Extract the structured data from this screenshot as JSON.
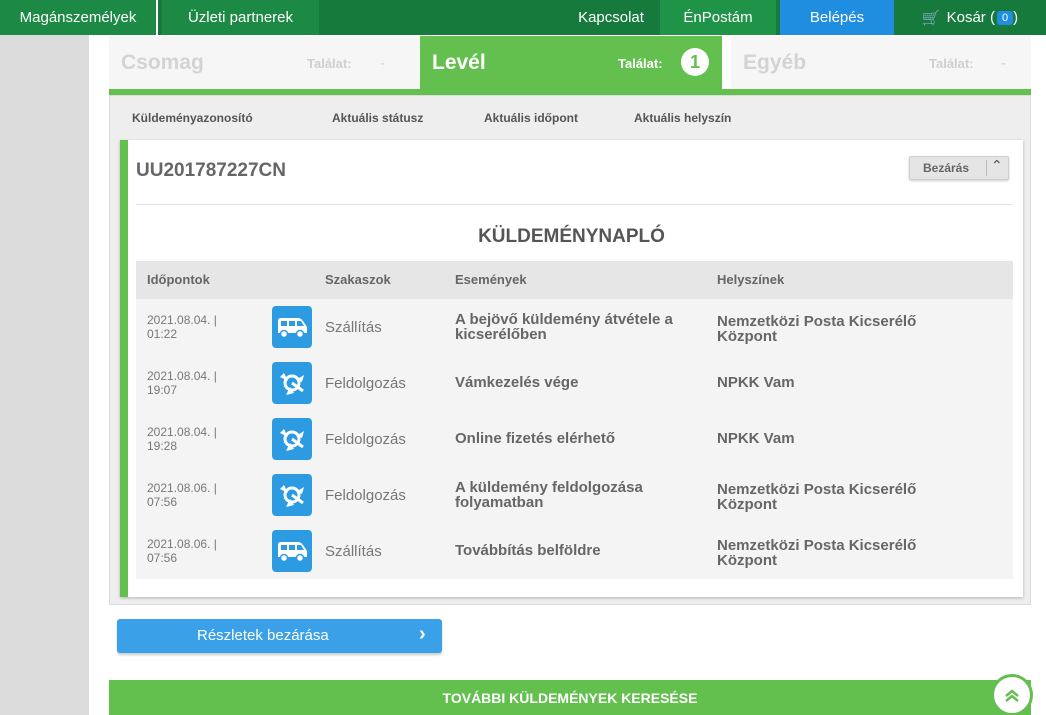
{
  "topnav": {
    "private_label": "Magánszemélyek",
    "business_label": "Üzleti partnerek",
    "contact_label": "Kapcsolat",
    "enpostam_label": "ÉnPostám",
    "login_label": "Belépés",
    "cart_label": "Kosár (",
    "cart_count": "0",
    "cart_close": ")"
  },
  "categories": {
    "csomag": {
      "name": "Csomag",
      "hit_label": "Találat:",
      "hit_value": "-"
    },
    "level": {
      "name": "Levél",
      "hit_label": "Találat:",
      "hit_value": "1"
    },
    "egyeb": {
      "name": "Egyéb",
      "hit_label": "Találat:",
      "hit_value": "-"
    }
  },
  "columns": {
    "id": "Küldeményazonosító",
    "status": "Aktuális státusz",
    "time": "Aktuális időpont",
    "location": "Aktuális helyszín"
  },
  "shipment": {
    "tracking_id": "UU201787227CN",
    "close_label": "Bezárás",
    "log_title": "KÜLDEMÉNYNAPLÓ",
    "headers": {
      "time": "Időpontok",
      "stage": "Szakaszok",
      "event": "Események",
      "location": "Helyszínek"
    },
    "rows": [
      {
        "date": "2021.08.04. |",
        "time": "01:22",
        "icon": "van-icon",
        "stage": "Szállítás",
        "event": "A bejövő küldemény átvétele a kicserélőben",
        "location": "Nemzetközi Posta Kicserélő Központ"
      },
      {
        "date": "2021.08.04. |",
        "time": "19:07",
        "icon": "processing-icon",
        "stage": "Feldolgozás",
        "event": "Vámkezelés vége",
        "location": "NPKK Vam"
      },
      {
        "date": "2021.08.04. |",
        "time": "19:28",
        "icon": "processing-icon",
        "stage": "Feldolgozás",
        "event": "Online fizetés elérhető",
        "location": "NPKK Vam"
      },
      {
        "date": "2021.08.06. |",
        "time": "07:56",
        "icon": "processing-icon",
        "stage": "Feldolgozás",
        "event": "A küldemény feldolgozása folyamatban",
        "location": "Nemzetközi Posta Kicserélő Központ"
      },
      {
        "date": "2021.08.06. |",
        "time": "07:56",
        "icon": "van-icon",
        "stage": "Szállítás",
        "event": "Továbbítás belföldre",
        "location": "Nemzetközi Posta Kicserélő Központ"
      }
    ]
  },
  "buttons": {
    "details_close": "Részletek bezárása",
    "more_search": "TOVÁBBI KÜLDEMÉNYEK KERESÉSE"
  },
  "colors": {
    "brand_green": "#63c04e",
    "nav_green": "#167a3c",
    "accent_blue": "#2d9be2"
  }
}
